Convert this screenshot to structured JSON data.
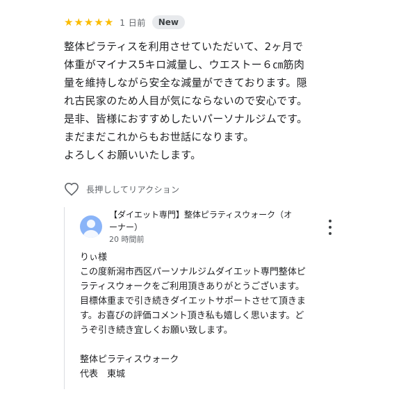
{
  "review": {
    "rating": 5,
    "date": "1 日前",
    "badge": "New",
    "text": "整体ピラティスを利用させていただいて、2ヶ月で\n体重がマイナス5キロ減量し、ウエストー６㎝筋肉\n量を維持しながら安全な減量ができております。隠\nれ古民家のため人目が気にならないので安心です。\n是非、皆様におすすめしたいパーソナルジムです。\nまだまだこれからもお世話になります。\nよろしくお願いいたします。"
  },
  "reaction": {
    "icon": "heart-icon",
    "label": "長押ししてリアクション"
  },
  "owner_reply": {
    "name": "【ダイエット専門】整体ピラティスウォーク（オ\nーナー）",
    "date": "20 時間前",
    "text": "りぃ様\nこの度新潟市西区パーソナルジムダイエット専門整体ピ\nラティスウォークをご利用頂きありがとうございます。\n目標体重まで引き続きダイエットサポートさせて頂きま\nす。お喜びの評価コメント頂き私も嬉しく思います。ど\nうぞ引き続き宜しくお願い致します。\n\n整体ピラティスウォーク\n代表　東城",
    "avatar_color": "#8ab4f8"
  },
  "colors": {
    "star": "#fbbc04",
    "badge_bg": "#e8eaed"
  }
}
